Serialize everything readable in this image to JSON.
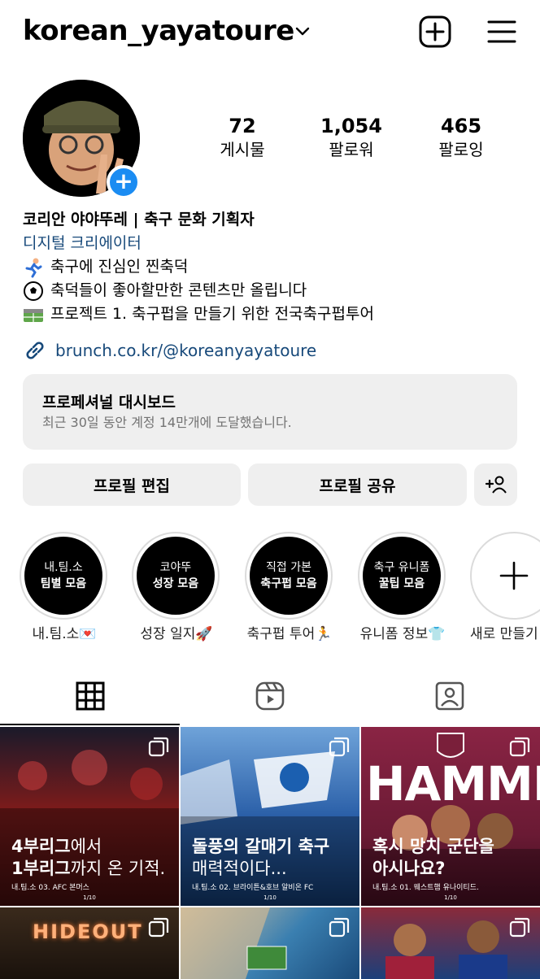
{
  "header": {
    "username": "korean_yayatoure",
    "icons": [
      "chevron-down-icon",
      "add-square-icon",
      "menu-icon"
    ]
  },
  "profile": {
    "stats": [
      {
        "value": "72",
        "label": "게시물"
      },
      {
        "value": "1,054",
        "label": "팔로워"
      },
      {
        "value": "465",
        "label": "팔로잉"
      }
    ]
  },
  "bio": {
    "name": "코리안 야야뚜레 | 축구 문화 기획자",
    "category": "디지털 크리에이터",
    "lines": [
      {
        "emoji": "runner-emoji",
        "text": "축구에 진심인 찐축덕"
      },
      {
        "emoji": "soccer-ball-emoji",
        "text": "축덕들이 좋아할만한 콘텐츠만 올립니다"
      },
      {
        "emoji": "stadium-emoji",
        "text": "프로젝트 1. 축구펍을 만들기 위한 전국축구펍투어"
      }
    ],
    "link": "brunch.co.kr/@koreanyayatoure"
  },
  "dashboard": {
    "title": "프로페셔널 대시보드",
    "subtitle": "최근 30일 동안 계정 14만개에 도달했습니다."
  },
  "actions": {
    "edit_profile": "프로필 편집",
    "share_profile": "프로필 공유"
  },
  "highlights": [
    {
      "line1": "내.팀.소",
      "line2": "팀별 모음",
      "label": "내.팀.소💌"
    },
    {
      "line1": "코야뚜",
      "line2": "성장 모음",
      "label": "성장 일지🚀"
    },
    {
      "line1": "직접 가본",
      "line2": "축구펍 모음",
      "label": "축구펍 투어🏃"
    },
    {
      "line1": "축구 유니폼",
      "line2": "꿀팁 모음",
      "label": "유니폼 정보👕"
    },
    {
      "label": "새로 만들기"
    }
  ],
  "tabs": [
    "grid-icon",
    "reels-icon",
    "tagged-icon"
  ],
  "posts": [
    {
      "title_bold1": "4부리그",
      "title_light1": "에서",
      "title_bold2": "1부리그",
      "title_light2": "까지 온 기적.",
      "sub": "내.팀.소 03. AFC 본머스",
      "page": "1/10",
      "bg": "#7a1b1b"
    },
    {
      "title_bold1": "돌풍의 갈매기 축구",
      "title_light2": "매력적이다...",
      "sub": "내.팀.소 02. 브라이튼&호브 알비온 FC",
      "page": "1/10",
      "bg": "#2a5fa8"
    },
    {
      "headline": "HAMMERS",
      "title_bold1": "혹시 망치 군단을",
      "title_bold2": "아시나요?",
      "sub": "내.팀.소 01. 웨스트햄 유나이티드.",
      "page": "1/10",
      "bg": "#7a1f3a"
    },
    {
      "headline": "HIDEOUT",
      "bg": "#2a1c14"
    },
    {
      "bg": "#3a7fb0"
    },
    {
      "bg": "#1c3f7a"
    }
  ]
}
